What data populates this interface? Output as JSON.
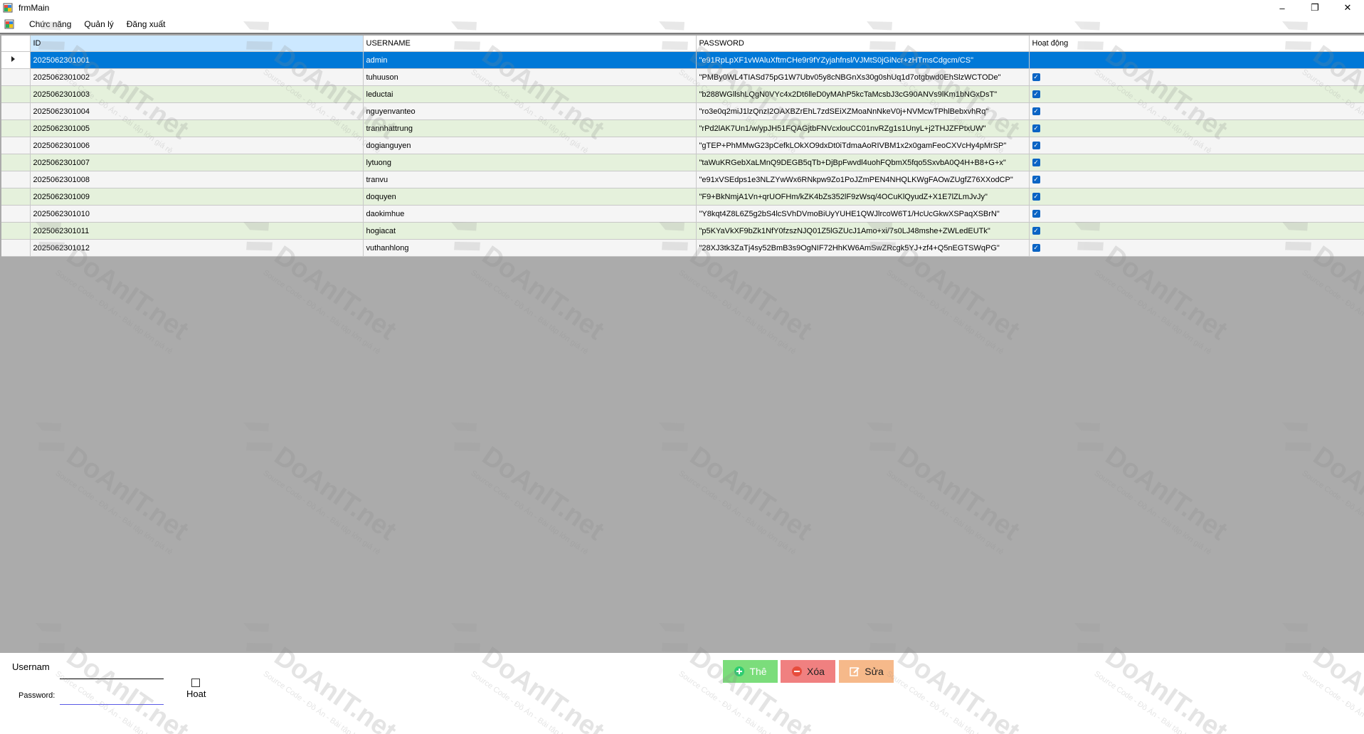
{
  "window": {
    "title": "frmMain",
    "minimize": "–",
    "maximize": "❐",
    "close": "✕"
  },
  "menu": {
    "items": [
      "Chức năng",
      "Quản lý",
      "Đăng xuất"
    ],
    "mdi": {
      "minimize": "–",
      "restore": "❐",
      "close": "✕"
    }
  },
  "grid": {
    "columns": [
      "ID",
      "USERNAME",
      "PASSWORD",
      "Hoạt động"
    ],
    "rows": [
      {
        "id": "2025062301001",
        "username": "admin",
        "password": "\"e91RpLpXF1vWAluXftmCHe9r9fYZyjahfnsl/VJMtS0jGiNcr+zHTmsCdgcm/CS\"",
        "active": ""
      },
      {
        "id": "2025062301002",
        "username": "tuhuuson",
        "password": "\"PMBy0WL4TIASd75pG1W7Ubv05y8cNBGnXs30g0shUq1d7otgbwd0EhSlzWCTODe\"",
        "active": "✓"
      },
      {
        "id": "2025062301003",
        "username": "leductai",
        "password": "\"b288WGllshLQgN0VYc4x2Dt6lleD0yMAhP5kcTaMcsbJ3cG90ANVs9lKm1bNGxDsT\"",
        "active": "✓"
      },
      {
        "id": "2025062301004",
        "username": "nguyenvanteo",
        "password": "\"ro3e0q2miJ1lzQnzI2OAXBZrEhL7zdSEiXZMoaNnNkeV0j+NVMcwTPhlBebxvhRq\"",
        "active": "✓"
      },
      {
        "id": "2025062301005",
        "username": "trannhattrung",
        "password": "\"rPd2lAK7Un1/w/ypJH51FQAGjtbFNVcxlouCC01nvRZg1s1UnyL+j2THJZFPtxUW\"",
        "active": "✓"
      },
      {
        "id": "2025062301006",
        "username": "dogianguyen",
        "password": "\"gTEP+PhMMwG23pCefkLOkXO9dxDt0iTdmaAoRIVBM1x2x0gamFeoCXVcHy4pMrSP\"",
        "active": "✓"
      },
      {
        "id": "2025062301007",
        "username": "lytuong",
        "password": "\"taWuKRGebXaLMnQ9DEGB5qTb+DjBpFwvdl4uohFQbmX5fqo5SxvbA0Q4H+B8+G+x\"",
        "active": "✓"
      },
      {
        "id": "2025062301008",
        "username": "tranvu",
        "password": "\"e91xVSEdps1e3NLZYwWx6RNkpw9Zo1PoJZmPEN4NHQLKWgFAOwZUgfZ76XXodCP\"",
        "active": "✓"
      },
      {
        "id": "2025062301009",
        "username": "doquyen",
        "password": "\"F9+BkNmjA1Vn+qrUOFHm/kZK4bZs352lF9zWsq/4OCuKlQyudZ+X1E7lZLmJvJy\"",
        "active": "✓"
      },
      {
        "id": "2025062301010",
        "username": "daokimhue",
        "password": "\"Y8kqt4Z8L6Z5g2bS4lcSVhDVmoBiUyYUHE1QWJlrcoW6T1/HcUcGkwXSPaqXSBrN\"",
        "active": "✓"
      },
      {
        "id": "2025062301011",
        "username": "hogiacat",
        "password": "\"p5KYaVkXF9bZk1NfY0fzszNJQ01Z5lGZUcJ1Amo+xi/7s0LJ48mshe+ZWLedEUTk\"",
        "active": "✓"
      },
      {
        "id": "2025062301012",
        "username": "vuthanhlong",
        "password": "\"28XJ3tk3ZaTj4sy52BmB3s9OgNIF72HhKW6AmSwZRcgk5YJ+zf4+Q5nEGTSWqPG\"",
        "active": "✓"
      }
    ]
  },
  "form": {
    "username_label": "Usernam",
    "password_label": "Password:",
    "active_label": "Hoat"
  },
  "buttons": {
    "add": "Thê",
    "delete": "Xóa",
    "edit": "Sửa"
  },
  "watermark": {
    "brand": "DoAnIT.net",
    "tagline": "Source Code - Đồ Án - Bài tập lớn giá rẻ"
  },
  "colors": {
    "selected_row": "#0078d7",
    "alt_row": "#e5f1dc",
    "grid_background": "#ababab",
    "add_button": "#7bdd7b",
    "delete_button": "#f08080",
    "edit_button": "#f6b98a"
  }
}
